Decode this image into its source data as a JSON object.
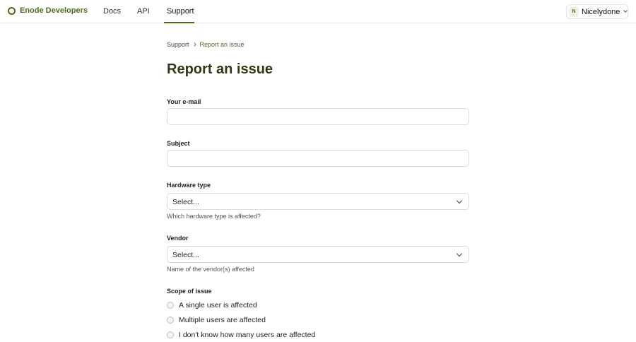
{
  "header": {
    "brand": "Enode Developers",
    "nav": [
      {
        "label": "Docs"
      },
      {
        "label": "API"
      },
      {
        "label": "Support",
        "active": true
      }
    ],
    "account": {
      "initial": "N",
      "name": "Nicelydone"
    }
  },
  "breadcrumb": {
    "parent": "Support",
    "current": "Report an issue"
  },
  "page_title": "Report an issue",
  "form": {
    "email": {
      "label": "Your e-mail",
      "value": ""
    },
    "subject": {
      "label": "Subject",
      "value": ""
    },
    "hardware_type": {
      "label": "Hardware type",
      "value": "Select...",
      "help": "Which hardware type is affected?"
    },
    "vendor": {
      "label": "Vendor",
      "value": "Select...",
      "help": "Name of the vendor(s) affected"
    },
    "scope": {
      "label": "Scope of issue",
      "options": [
        {
          "label": "A single user is affected",
          "selected": false
        },
        {
          "label": "Multiple users are affected",
          "selected": false
        },
        {
          "label": "I don't know how many users are affected",
          "selected": false
        }
      ]
    }
  },
  "colors": {
    "brand": "#4d6b1e",
    "title": "#2d3c12",
    "border": "#dcdcdc"
  }
}
